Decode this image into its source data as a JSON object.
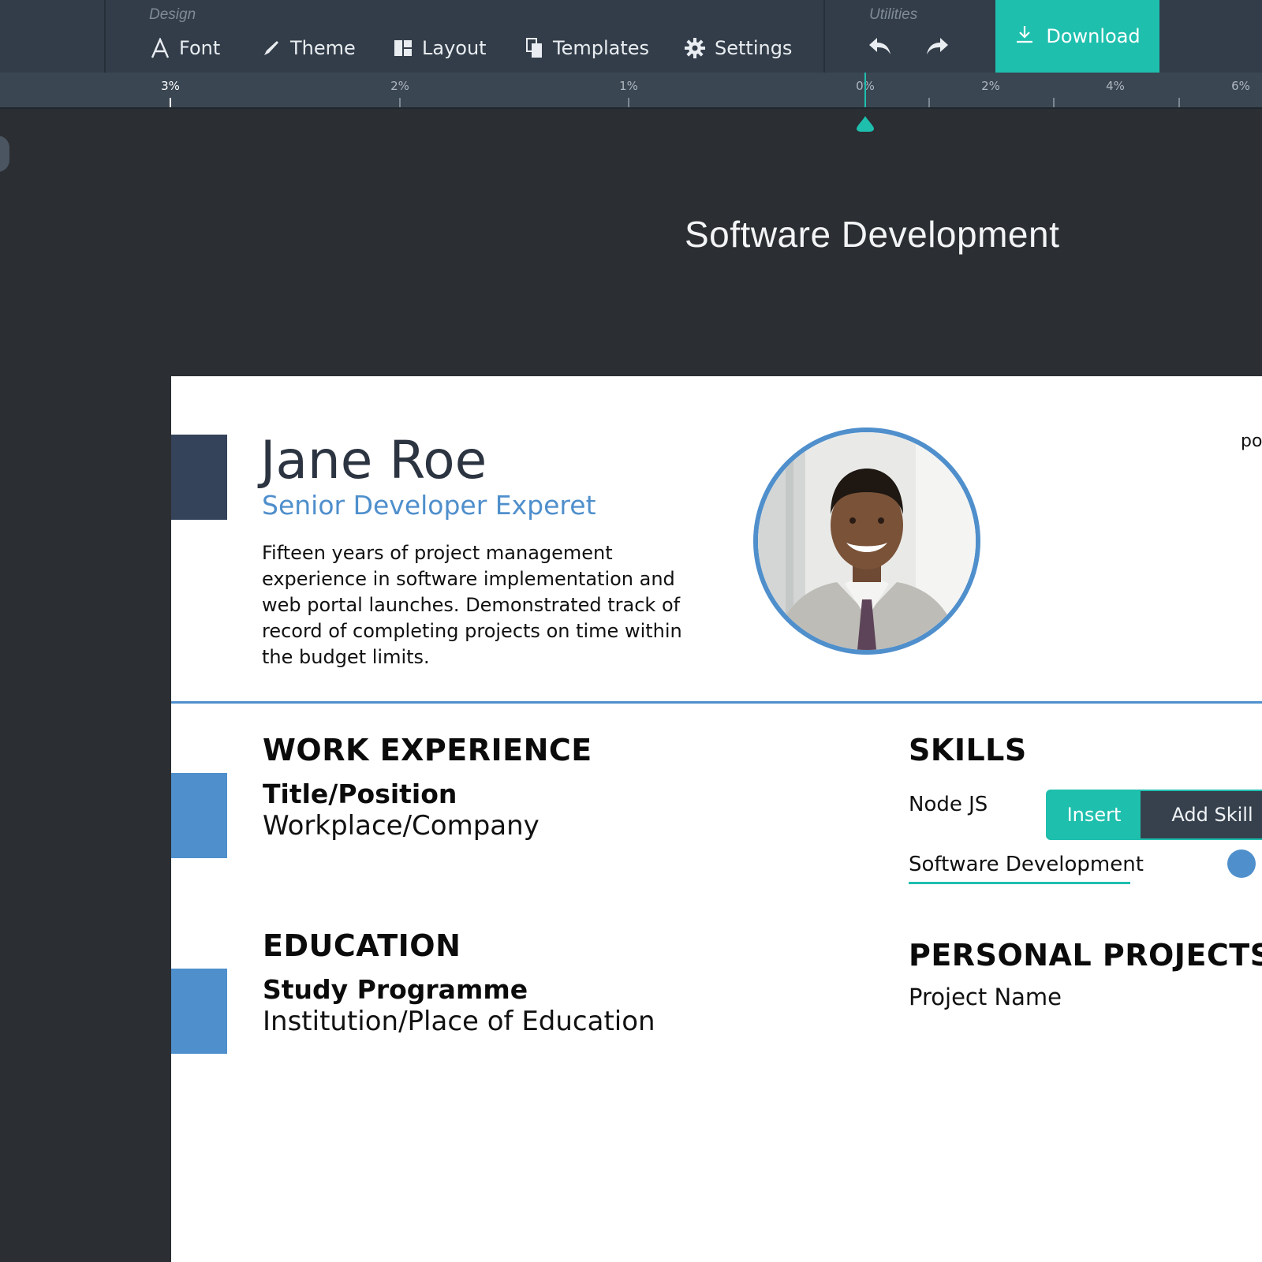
{
  "toolbar": {
    "design_label": "Design",
    "utilities_label": "Utilities",
    "tools": {
      "font": "Font",
      "theme": "Theme",
      "layout": "Layout",
      "templates": "Templates",
      "settings": "Settings"
    },
    "download_label": "Download",
    "accent_color": "#1fbfae"
  },
  "ruler": {
    "labels": [
      "3%",
      "2%",
      "1%",
      "0%",
      "2%",
      "4%",
      "6%"
    ],
    "active_label": "3%"
  },
  "canvas_title": "Software Development",
  "resume": {
    "name": "Jane Roe",
    "role": "Senior Developer Experet",
    "summary": "Fifteen years of project management experience in software implementation and web portal launches. Demonstrated track of record of completing projects on time within the budget limits.",
    "cut_text": "po",
    "accent_color": "#4f8fcc",
    "work": {
      "heading": "WORK EXPERIENCE",
      "title": "Title/Position",
      "company": "Workplace/Company"
    },
    "education": {
      "heading": "EDUCATION",
      "programme": "Study Programme",
      "institution": "Institution/Place of Education"
    },
    "skills": {
      "heading": "SKILLS",
      "items": [
        "Node JS",
        "Software Development"
      ],
      "insert_label": "Insert",
      "add_skill_label": "Add Skill"
    },
    "projects": {
      "heading": "PERSONAL PROJECTS",
      "name": "Project Name"
    }
  }
}
